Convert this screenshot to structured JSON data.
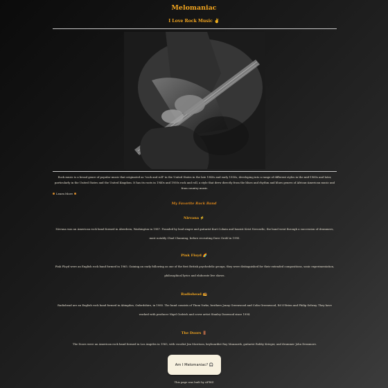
{
  "header": {
    "title": "Melomaniac",
    "subtitle": "I Love Rock Music ✌"
  },
  "hero": {
    "alt": "Close-up of a person playing an electric guitar"
  },
  "intro": {
    "text": "Rock music is a broad genre of popular music that originated as \"rock and roll\" in the United States in the late 1940s and early 1950s, developing into a range of different styles in the mid-1960s and later, particularly in the United States and the United Kingdom. It has its roots in 1940s and 1950s rock and roll, a style that drew directly from the blues and rhythm and blues genres of African-American music and from country music.",
    "learn_more": "Learn More"
  },
  "favorites": {
    "title": "My Favorite Rock Band",
    "bands": [
      {
        "name": "Nirvana ⚡",
        "desc": "Nirvana was an American rock band formed in Aberdeen, Washington in 1987. Founded by lead singer and guitarist Kurt Cobain and bassist Krist Novoselic, the band went through a succession of drummers, most notably Chad Channing, before recruiting Dave Grohl in 1990."
      },
      {
        "name": "Pink Floyd 🌈",
        "desc": "Pink Floyd were an English rock band formed in 1965. Gaining an early following as one of the first British psychedelic groups, they were distinguished for their extended compositions, sonic experimentation, philosophical lyrics and elaborate live shows."
      },
      {
        "name": "Radiohead 📻",
        "desc": "Radiohead are an English rock band formed in Abingdon, Oxfordshire, in 1985. The band consists of Thom Yorke, brothers Jonny Greenwood and Colin Greenwood, Ed O'Brien and Philip Selway. They have worked with producer Nigel Godrich and cover artist Stanley Donwood since 1994."
      },
      {
        "name": "The Doors 🚪",
        "desc": "The Doors were an American rock band formed in Los Angeles in 1965, with vocalist Jim Morrison, keyboardist Ray Manzarek, guitarist Robby Krieger, and drummer John Densmore."
      }
    ]
  },
  "cta": {
    "label": "Am I Melomaniac? 🎧"
  },
  "footer": {
    "text": "This page was built by AFRIZ"
  },
  "colors": {
    "accent": "#f2a51f",
    "text": "#e7e1d2",
    "button_bg": "#f7f1df"
  }
}
